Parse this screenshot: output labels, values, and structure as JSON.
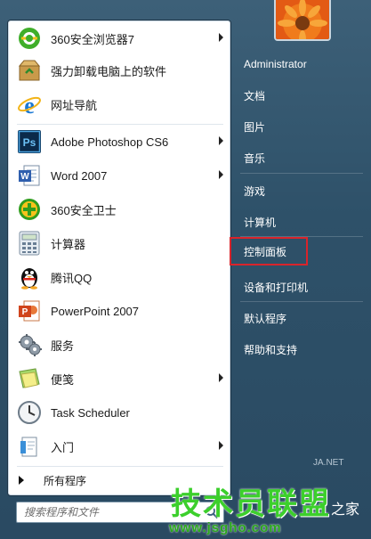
{
  "left_panel": {
    "items": [
      {
        "label": "360安全浏览器7",
        "icon": "360-browser-icon",
        "has_submenu": true
      },
      {
        "label": "强力卸载电脑上的软件",
        "icon": "uninstall-box-icon",
        "has_submenu": false
      },
      {
        "label": "网址导航",
        "icon": "ie-icon",
        "has_submenu": false
      },
      {
        "label": "Adobe Photoshop CS6",
        "icon": "photoshop-icon",
        "has_submenu": true
      },
      {
        "label": "Word 2007",
        "icon": "word-icon",
        "has_submenu": true
      },
      {
        "label": "360安全卫士",
        "icon": "360-safeguard-icon",
        "has_submenu": false
      },
      {
        "label": "计算器",
        "icon": "calculator-icon",
        "has_submenu": false
      },
      {
        "label": "腾讯QQ",
        "icon": "qq-penguin-icon",
        "has_submenu": false
      },
      {
        "label": "PowerPoint 2007",
        "icon": "powerpoint-icon",
        "has_submenu": false
      },
      {
        "label": "服务",
        "icon": "services-gear-icon",
        "has_submenu": false
      },
      {
        "label": "便笺",
        "icon": "sticky-notes-icon",
        "has_submenu": true
      },
      {
        "label": "Task Scheduler",
        "icon": "clock-icon",
        "has_submenu": false
      },
      {
        "label": "入门",
        "icon": "getting-started-icon",
        "has_submenu": true
      }
    ],
    "all_programs": "所有程序"
  },
  "search": {
    "placeholder": "搜索程序和文件"
  },
  "right_panel": {
    "items": [
      {
        "label": "Administrator"
      },
      {
        "label": "文档"
      },
      {
        "label": "图片"
      },
      {
        "label": "音乐"
      },
      {
        "label": "游戏"
      },
      {
        "label": "计算机"
      },
      {
        "label": "控制面板",
        "highlighted": true
      },
      {
        "label": "设备和打印机"
      },
      {
        "label": "默认程序"
      },
      {
        "label": "帮助和支持"
      }
    ]
  },
  "watermark": {
    "brand": "技术员联盟",
    "suffix": "之家",
    "url": "www.jsgho.com",
    "faint_url": "JA.NET"
  },
  "colors": {
    "highlight": "#d9242b",
    "watermark_green": "#3ccf2c"
  }
}
